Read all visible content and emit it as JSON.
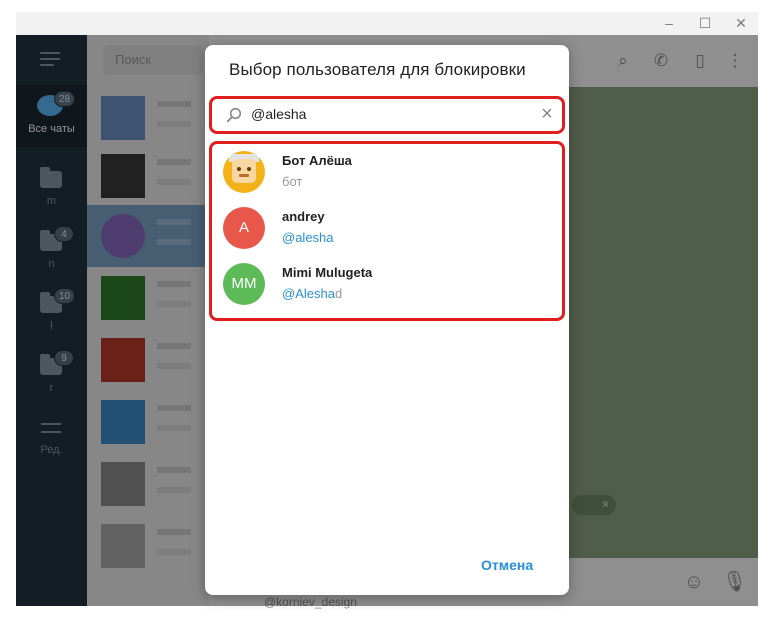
{
  "window": {
    "controls": {
      "minimize": "–",
      "maximize": "☐",
      "close": "✕"
    }
  },
  "rail": {
    "items": [
      {
        "label": "Все чаты",
        "badge": "28"
      },
      {
        "label": "m",
        "badge": ""
      },
      {
        "label": "n",
        "badge": "4"
      },
      {
        "label": "l",
        "badge": "10"
      },
      {
        "label": "r",
        "badge": "9"
      },
      {
        "label": "Ред.",
        "badge": ""
      }
    ]
  },
  "chatlist": {
    "search_placeholder": "Поиск"
  },
  "background": {
    "bottom_hint": "@korniev_design",
    "chip": "я"
  },
  "dialog": {
    "title": "Выбор пользователя для блокировки",
    "search_value": "@alesha",
    "results": [
      {
        "name": "Бот Алёша",
        "subtitle": "бот",
        "avatar": "bot-image"
      },
      {
        "name": "andrey",
        "subtitle": "@alesha",
        "avatar_initials": "A",
        "avatar_color": "#e8584a"
      },
      {
        "name": "Mimi Mulugeta",
        "subtitle_highlight": "@Alesha",
        "subtitle_rest": "d",
        "avatar_initials": "MM",
        "avatar_color": "#5dbb5a"
      }
    ],
    "cancel_label": "Отмена"
  },
  "colors": {
    "accent": "#2a8fd4",
    "highlight_border": "#e01e1e",
    "rail_bg": "#22323f"
  },
  "icons": [
    "search-icon",
    "phone-icon",
    "sidebar-toggle-icon",
    "more-vert-icon",
    "emoji-icon",
    "microphone-icon",
    "clear-icon",
    "menu-icon",
    "folder-icon",
    "edit-filters-icon"
  ]
}
